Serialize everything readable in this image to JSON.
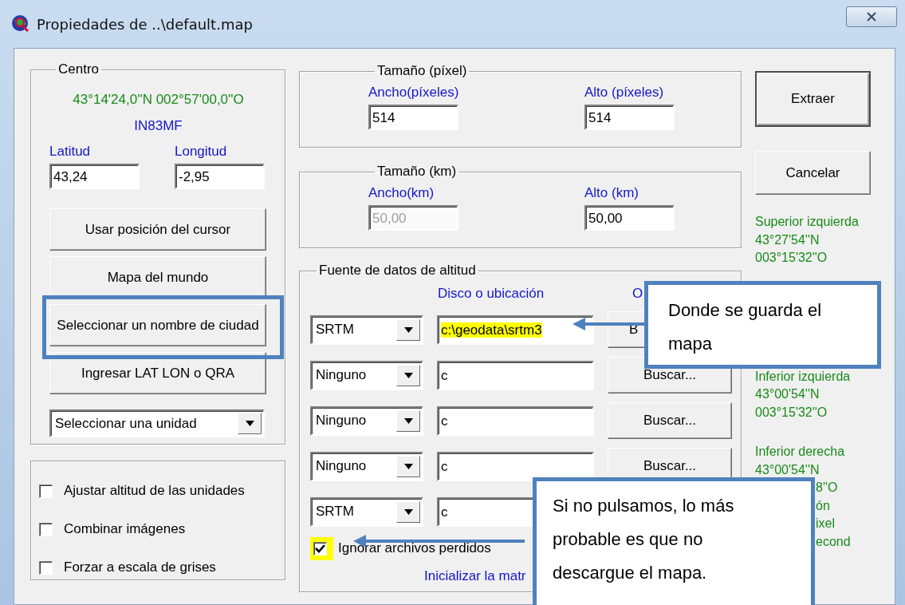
{
  "window": {
    "title": "Propiedades de ..\\default.map"
  },
  "centro": {
    "title": "Centro",
    "coords": "43°14'24,0''N 002°57'00,0''O",
    "locator": "IN83MF",
    "fields": [
      {
        "label": "Latitud",
        "value": "43,24"
      },
      {
        "label": "Longitud",
        "value": "-2,95"
      }
    ],
    "buttons": [
      {
        "label": "Usar posición del cursor",
        "marked": false
      },
      {
        "label": "Mapa del mundo",
        "marked": false
      },
      {
        "label": "Seleccionar un nombre de ciudad",
        "marked": true
      },
      {
        "label": "Ingresar LAT LON o QRA",
        "marked": false
      }
    ],
    "unit_select": "Seleccionar una unidad"
  },
  "options": [
    {
      "label": "Ajustar altitud de las unidades",
      "checked": false
    },
    {
      "label": "Combinar imágenes",
      "checked": false
    },
    {
      "label": "Forzar a escala de grises",
      "checked": false
    }
  ],
  "size_groups": [
    {
      "title": "Tamaño (píxel)",
      "fields": [
        {
          "label": "Ancho(píxeles)",
          "value": "514",
          "disabled": false
        },
        {
          "label": "Alto (píxeles)",
          "value": "514",
          "disabled": false
        }
      ]
    },
    {
      "title": "Tamaño (km)",
      "fields": [
        {
          "label": "Ancho(km)",
          "value": "50,00",
          "disabled": true
        },
        {
          "label": "Alto (km)",
          "value": "50,00",
          "disabled": false
        }
      ]
    }
  ],
  "elevation": {
    "title": "Fuente de datos de altitud",
    "columns": [
      "Disco o ubicación",
      "O"
    ],
    "rows": [
      {
        "source": "SRTM",
        "path": "c:\\geodata\\srtm3",
        "highlighted": true,
        "button": "B"
      },
      {
        "source": "Ninguno",
        "path": "c",
        "highlighted": false,
        "button": "Buscar..."
      },
      {
        "source": "Ninguno",
        "path": "c",
        "highlighted": false,
        "button": "Buscar..."
      },
      {
        "source": "Ninguno",
        "path": "c",
        "highlighted": false,
        "button": "Buscar..."
      },
      {
        "source": "SRTM",
        "path": "c",
        "highlighted": false
      }
    ],
    "ignore_missing": {
      "label": "Ignorar archivos perdidos",
      "checked": true,
      "highlighted": true
    },
    "link": "Inicializar la matr"
  },
  "actions": [
    {
      "label": "Extraer",
      "default": true
    },
    {
      "label": "Cancelar",
      "default": false
    }
  ],
  "corners": [
    {
      "lines": [
        "Superior izquierda",
        "43°27'54''N",
        "003°15'32''O"
      ]
    },
    {
      "lines": [
        "Inferior izquierda",
        "43°00'54''N",
        "003°15'32''O"
      ]
    },
    {
      "lines": [
        "Inferior derecha",
        "43°00'54''N"
      ]
    }
  ],
  "covered_fragments": [
    "8''O",
    "ón",
    "ixel",
    "econd"
  ],
  "annotations": [
    {
      "text": "Donde se guarda el mapa"
    },
    {
      "text": "Si no pulsamos, lo más probable es que no descargue el mapa."
    }
  ]
}
